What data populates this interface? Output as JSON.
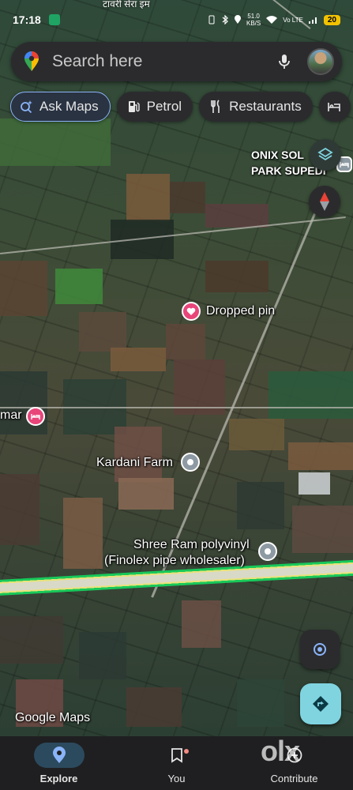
{
  "status_bar": {
    "time": "17:18",
    "speed": "51.0\nKB/S",
    "network": "Vo LTE",
    "battery": "20"
  },
  "top_place_label": "टावरी सेरा इम",
  "search": {
    "placeholder": "Search here",
    "icons": [
      "google-maps-pin-icon",
      "mic-icon",
      "avatar"
    ]
  },
  "chips": [
    {
      "label": "Ask Maps",
      "icon": "sparkle-search-icon"
    },
    {
      "label": "Petrol",
      "icon": "gas-station-icon"
    },
    {
      "label": "Restaurants",
      "icon": "fork-knife-icon"
    },
    {
      "label": "",
      "icon": "bed-icon"
    }
  ],
  "map_labels": {
    "onix": "ONIX SOL\nPARK SUPEDI",
    "dropped_pin": "Dropped pin",
    "hotel_partial": "mar",
    "kardani_farm": "Kardani Farm",
    "shree_ram_1": "Shree Ram polyvinyl",
    "shree_ram_2": "(Finolex pipe wholesaler)"
  },
  "google_logo": "Google Maps",
  "bottom_nav": [
    {
      "label": "Explore",
      "icon": "location-pin-icon",
      "active": true
    },
    {
      "label": "You",
      "icon": "bookmark-icon",
      "active": false
    },
    {
      "label": "Contribute",
      "icon": "add-circle-icon",
      "active": false
    }
  ],
  "watermark": "olx",
  "colors": {
    "accent": "#8ab4f8",
    "chip_bg": "#2b2b2e",
    "route_green": "#18c95a",
    "directions_bg": "#7fd4e0",
    "pin_pink": "#e8457a"
  }
}
